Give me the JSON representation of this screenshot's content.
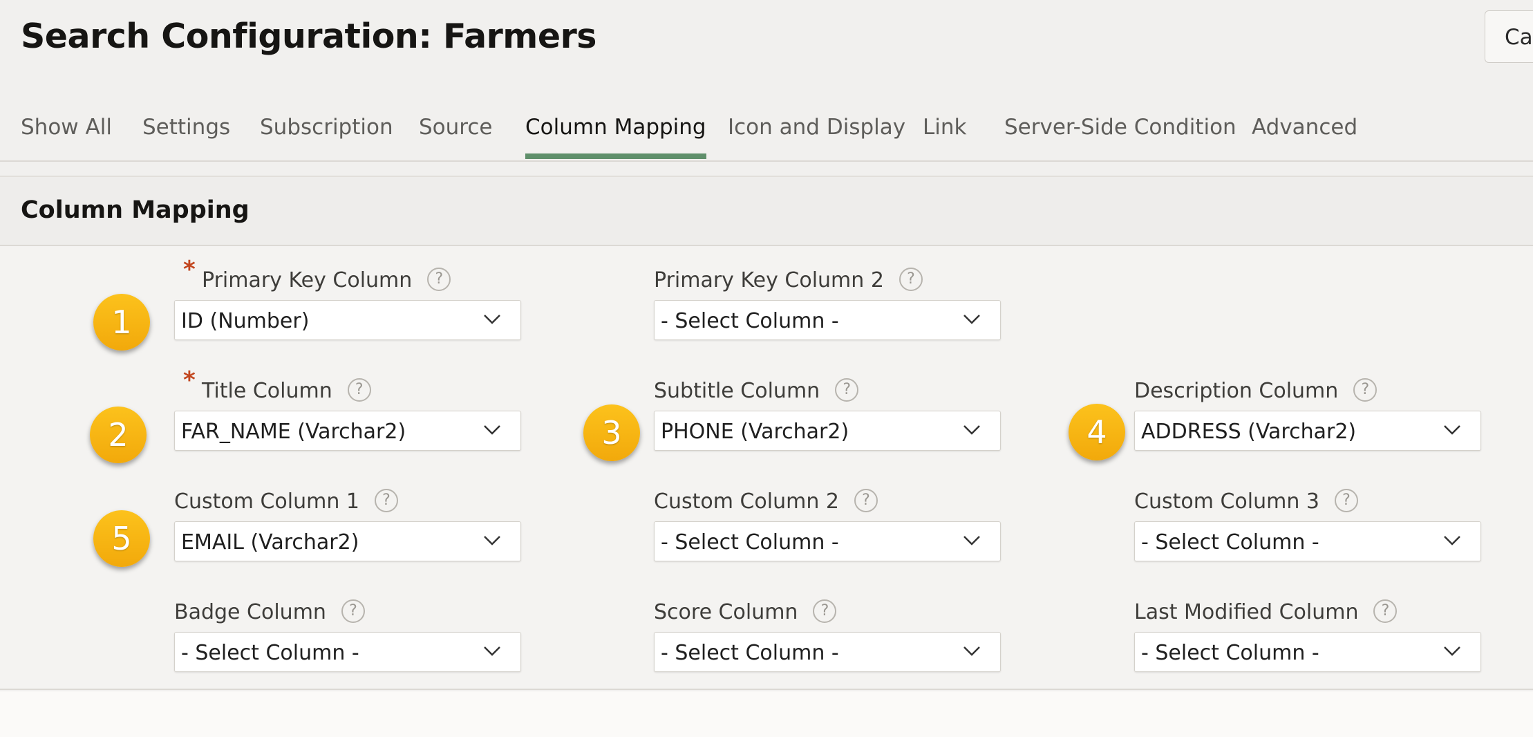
{
  "page": {
    "title": "Search Configuration: Farmers",
    "cancel_label": "Can"
  },
  "tabs": [
    {
      "label": "Show All"
    },
    {
      "label": "Settings"
    },
    {
      "label": "Subscription"
    },
    {
      "label": "Source"
    },
    {
      "label": "Column Mapping",
      "active": true
    },
    {
      "label": "Icon and Display"
    },
    {
      "label": "Link"
    },
    {
      "label": "Server-Side Condition"
    },
    {
      "label": "Advanced"
    }
  ],
  "region": {
    "title": "Column Mapping"
  },
  "fields": {
    "primary_key": {
      "label": "Primary Key Column",
      "value": "ID (Number)",
      "required": true
    },
    "primary_key_2": {
      "label": "Primary Key Column 2",
      "value": "- Select Column -"
    },
    "title": {
      "label": "Title Column",
      "value": "FAR_NAME (Varchar2)",
      "required": true
    },
    "subtitle": {
      "label": "Subtitle Column",
      "value": "PHONE (Varchar2)"
    },
    "description": {
      "label": "Description Column",
      "value": "ADDRESS (Varchar2)"
    },
    "custom_1": {
      "label": "Custom Column 1",
      "value": "EMAIL (Varchar2)"
    },
    "custom_2": {
      "label": "Custom Column 2",
      "value": "- Select Column -"
    },
    "custom_3": {
      "label": "Custom Column 3",
      "value": "- Select Column -"
    },
    "badge": {
      "label": "Badge Column",
      "value": "- Select Column -"
    },
    "score": {
      "label": "Score Column",
      "value": "- Select Column -"
    },
    "last_modified": {
      "label": "Last Modified Column",
      "value": "- Select Column -"
    }
  },
  "markers": [
    "1",
    "2",
    "3",
    "4",
    "5"
  ],
  "icons": {
    "help": "question-mark-circle-icon",
    "dropdown": "chevron-down-icon",
    "required": "asterisk"
  },
  "colors": {
    "active_tab_underline": "#5f8f6a",
    "required_asterisk": "#c2461f",
    "marker_badge": "#f5ae0f"
  }
}
